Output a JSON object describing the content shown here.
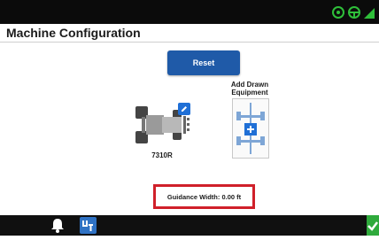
{
  "header": {
    "title": "Machine Configuration"
  },
  "reset": {
    "label": "Reset"
  },
  "tractor": {
    "name": "7310R"
  },
  "drawn_equipment": {
    "label": "Add Drawn Equipment"
  },
  "guidance": {
    "text": "Guidance Width: 0.00 ft"
  },
  "colors": {
    "accent_blue": "#1f5aa8",
    "highlight_red": "#d0202a",
    "status_green": "#2faa3c"
  },
  "icons": {
    "top_right": [
      "gps-signal-icon",
      "steering-status-icon",
      "signal-strength-icon"
    ],
    "bottom_bar": [
      "bell-icon",
      "screen-select-icon",
      "checkmark-icon"
    ]
  }
}
